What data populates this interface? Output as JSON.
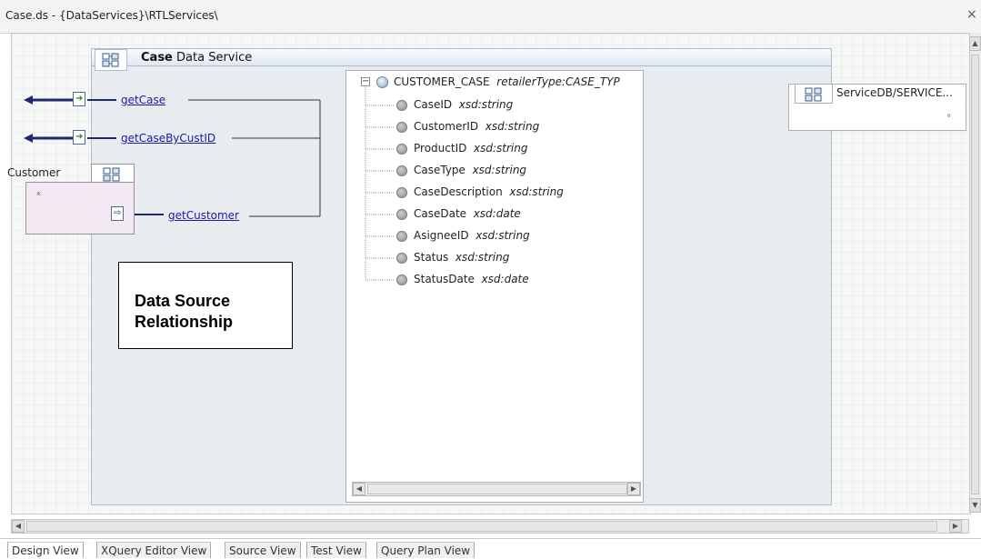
{
  "window": {
    "title": "Case.ds - {DataServices}\\RTLServices\\",
    "close": "×"
  },
  "service": {
    "name": "Case",
    "type_label": "Data Service"
  },
  "functions": [
    {
      "label": "getCase"
    },
    {
      "label": "getCaseByCustID"
    }
  ],
  "customer": {
    "label": "Customer",
    "chevron": "»",
    "function": "getCustomer"
  },
  "schema": {
    "root_name": "CUSTOMER_CASE",
    "root_type": "retailerType:CASE_TYP",
    "collapse": "−",
    "fields": [
      {
        "name": "CaseID",
        "type": "xsd:string"
      },
      {
        "name": "CustomerID",
        "type": "xsd:string"
      },
      {
        "name": "ProductID",
        "type": "xsd:string"
      },
      {
        "name": "CaseType",
        "type": "xsd:string"
      },
      {
        "name": "CaseDescription",
        "type": "xsd:string"
      },
      {
        "name": "CaseDate",
        "type": "xsd:date"
      },
      {
        "name": "AsigneeID",
        "type": "xsd:string"
      },
      {
        "name": "Status",
        "type": "xsd:string"
      },
      {
        "name": "StatusDate",
        "type": "xsd:date"
      }
    ]
  },
  "service_db": {
    "label": "ServiceDB/SERVICE...",
    "chevron": "»"
  },
  "annotation": {
    "line1": "Data Source",
    "line2": "Relationship"
  },
  "tabs": [
    {
      "label": "Design View",
      "active": true
    },
    {
      "label": "XQuery Editor View"
    },
    {
      "label": "Source View"
    },
    {
      "label": "Test View"
    },
    {
      "label": "Query Plan View"
    }
  ],
  "scroll": {
    "up": "▲",
    "down": "▼",
    "left": "◀",
    "right": "▶"
  },
  "colors": {
    "link": "#1a1aa6",
    "connector": "#1f2a6e",
    "arrow_head": "#2a8a2a",
    "panel_header": "#dfe9f2"
  }
}
